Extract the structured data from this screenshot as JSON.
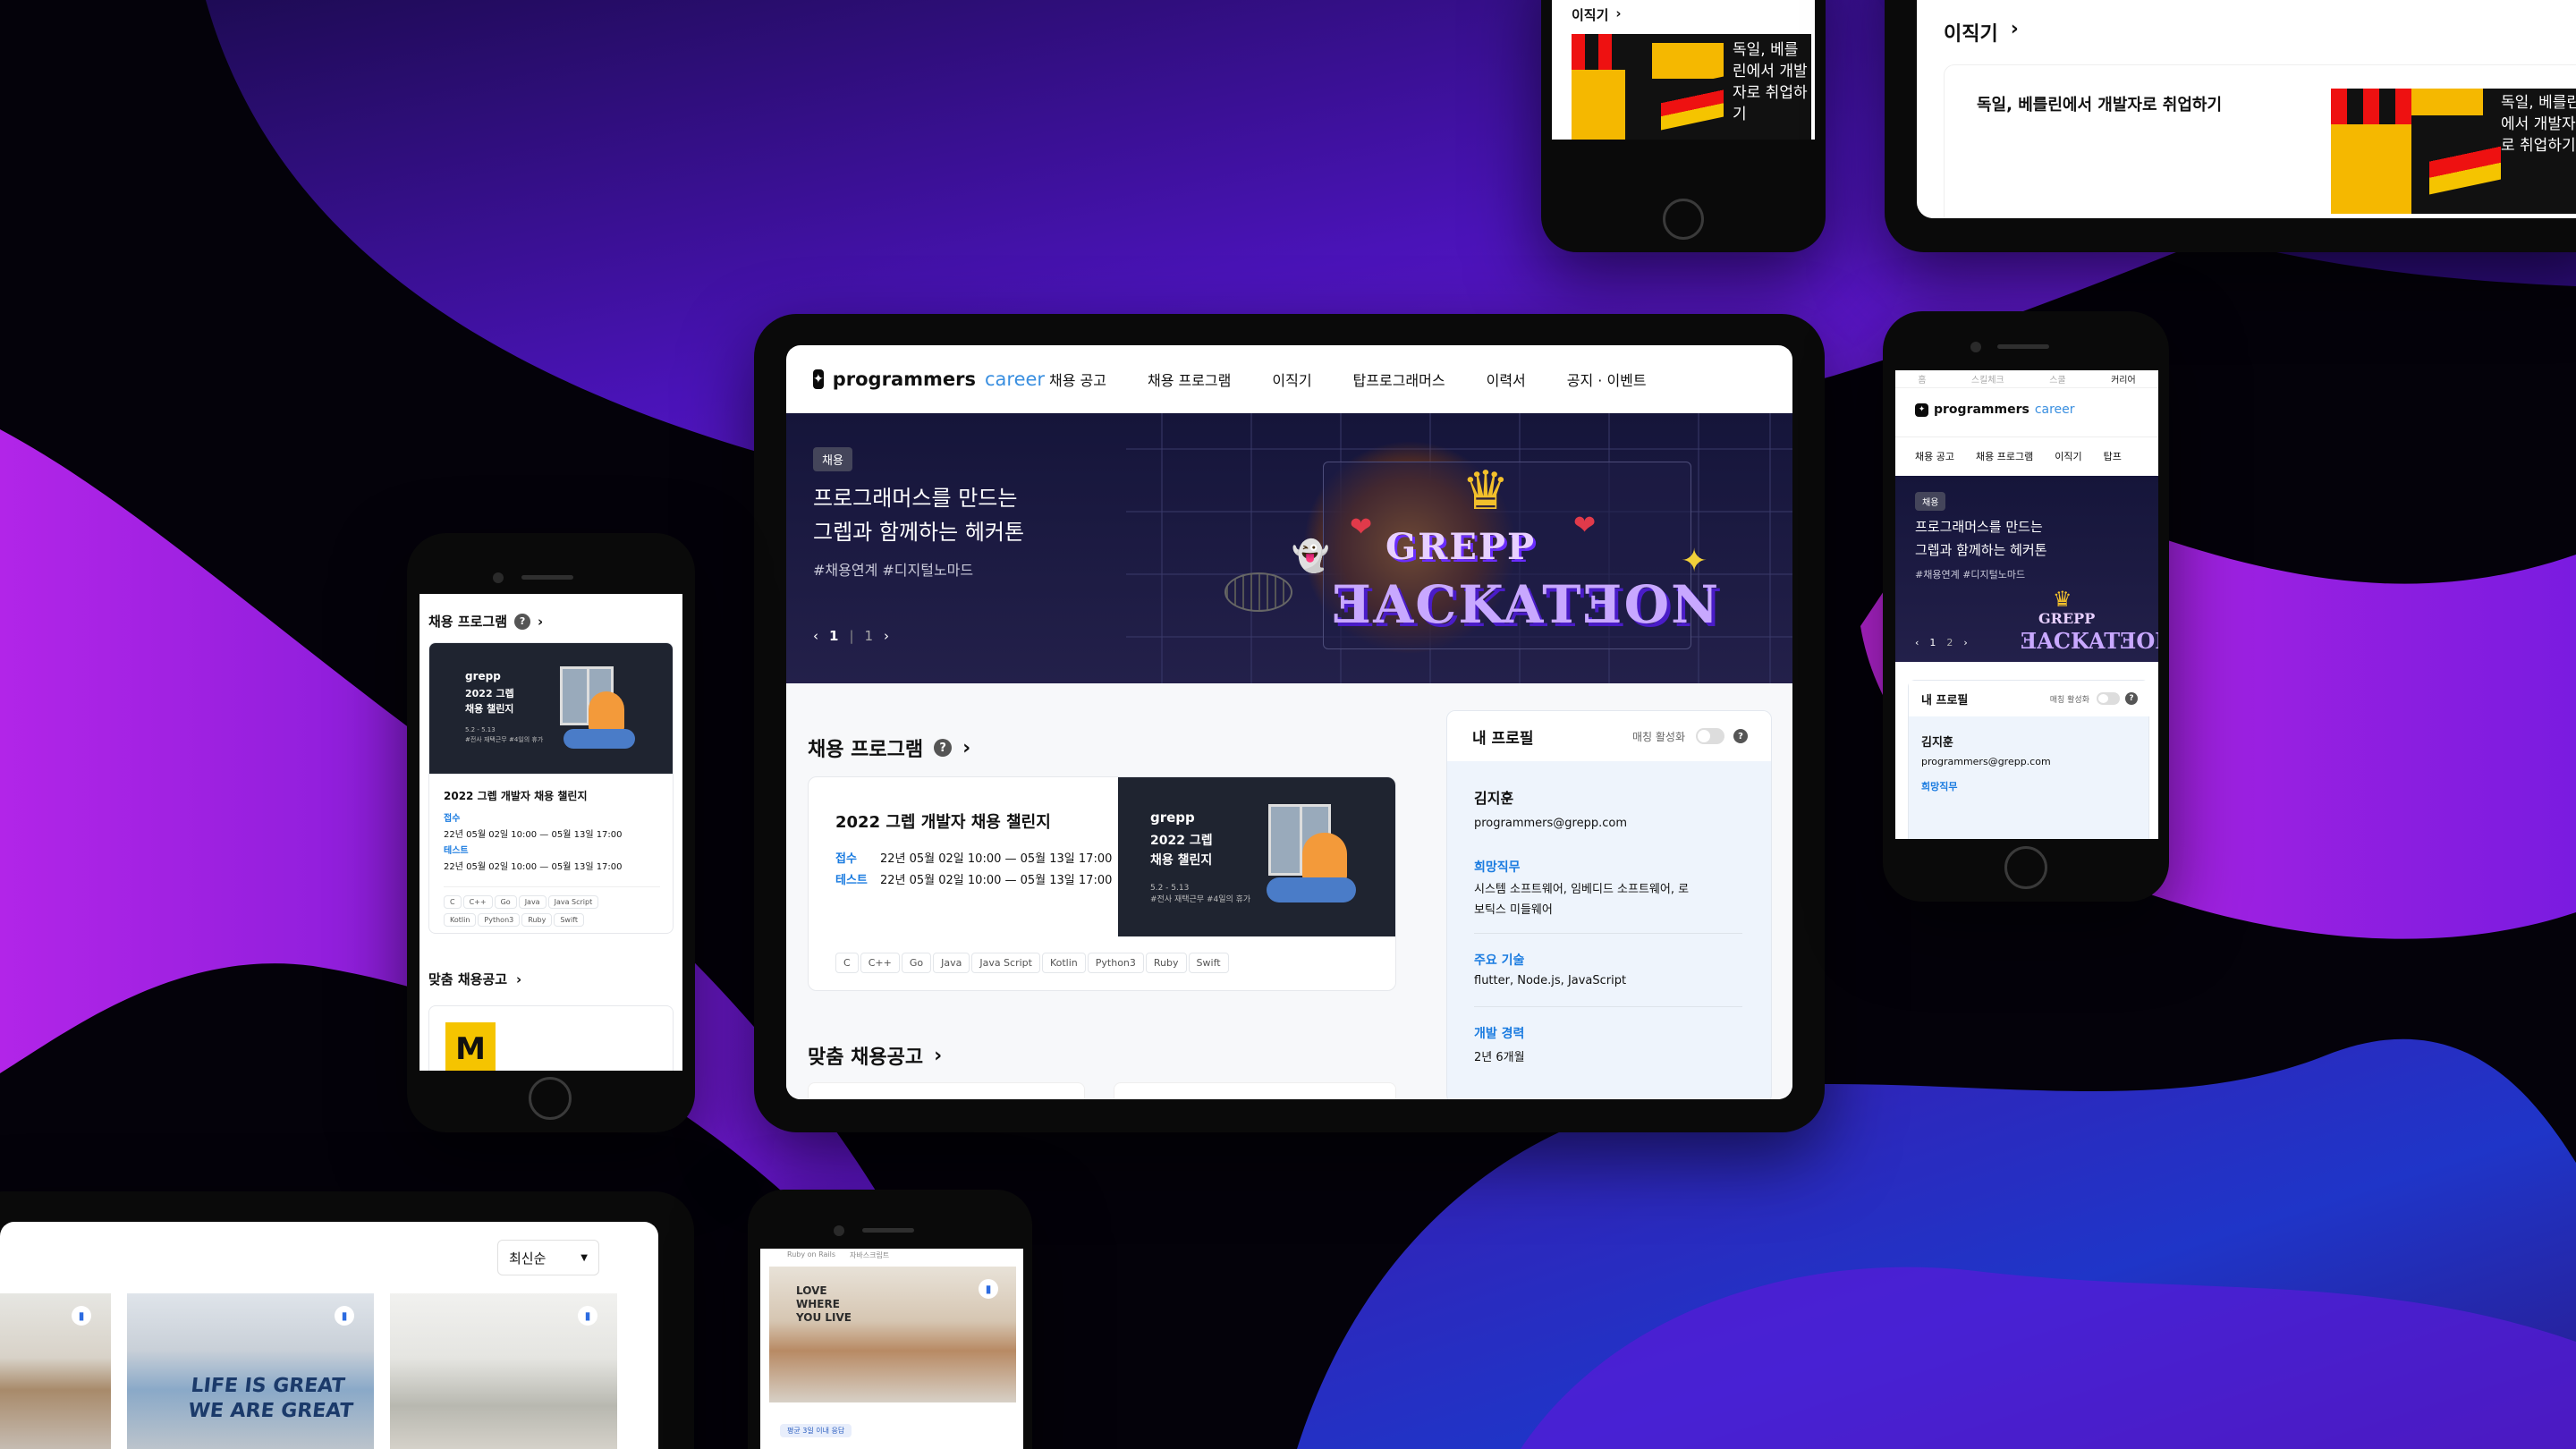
{
  "brand": {
    "name": "programmers",
    "suffix": "career"
  },
  "tablet": {
    "nav": [
      "채용 공고",
      "채용 프로그램",
      "이직기",
      "탑프로그래머스",
      "이력서",
      "공지 · 이벤트"
    ],
    "hero": {
      "badge": "채용",
      "title_line1": "프로그래머스를 만드는",
      "title_line2": "그렙과 함께하는 헤커톤",
      "tags": "#채용연계 #디지털노마드",
      "page_current": "1",
      "page_total": "1",
      "art_line1": "GREPP",
      "art_line2": "ƎACKATƎON"
    },
    "program_section": {
      "title": "채용 프로그램",
      "help": "?"
    },
    "program_card": {
      "title": "2022 그렙 개발자 채용 챌린지",
      "reception_label": "접수",
      "reception_value": "22년 05월 02일 10:00 — 05월 13일 17:00",
      "test_label": "테스트",
      "test_value": "22년 05월 02일 10:00 — 05월 13일 17:00",
      "poster_brand": "grepp",
      "poster_line1": "2022 그렙",
      "poster_line2": "채용 챌린지",
      "poster_date": "5.2 - 5.13",
      "poster_note": "#전사 재택근무 #4일의 휴가",
      "tags": [
        "C",
        "C++",
        "Go",
        "Java",
        "Java Script",
        "Kotlin",
        "Python3",
        "Ruby",
        "Swift"
      ]
    },
    "matching_section": {
      "title": "맞춤 채용공고"
    },
    "profile": {
      "title": "내 프로필",
      "matching_label": "매칭 활성화",
      "help": "?",
      "name": "김지훈",
      "email": "programmers@grepp.com",
      "desired_label": "희망직무",
      "desired_value": "시스템 소프트웨어, 임베디드 소프트웨어, 로보틱스 미들웨어",
      "skills_label": "주요 기술",
      "skills_value": "flutter, Node.js, JavaScript",
      "experience_label": "개발 경력",
      "experience_value": "2년 6개월"
    }
  },
  "phone_left": {
    "section_title": "채용 프로그램",
    "help": "?",
    "poster_brand": "grepp",
    "poster_line1": "2022 그렙",
    "poster_line2": "채용 챌린지",
    "poster_date": "5.2 - 5.13",
    "poster_note": "#전사 재택근무 #4일의 휴가",
    "card_title": "2022 그렙 개발자 채용 챌린지",
    "reception_label": "접수",
    "reception_value": "22년 05월 02일 10:00 — 05월 13일 17:00",
    "test_label": "테스트",
    "test_value": "22년 05월 02일 10:00 — 05월 13일 17:00",
    "tags_row1": [
      "C",
      "C++",
      "Go",
      "Java",
      "Java Script"
    ],
    "tags_row2": [
      "Kotlin",
      "Python3",
      "Ruby",
      "Swift"
    ],
    "matching_title": "맞춤 채용공고",
    "company_logo": "M"
  },
  "phone_right": {
    "top_tabs": [
      "홈",
      "스킬체크",
      "스쿨",
      "커리어"
    ],
    "nav": [
      "채용 공고",
      "채용 프로그램",
      "이직기",
      "탑프"
    ],
    "badge": "채용",
    "title_line1": "프로그래머스를 만드는",
    "title_line2": "그렙과 함께하는 헤커톤",
    "tags": "#채용연계 #디지털노마드",
    "page_current": "1",
    "page_total": "2",
    "art_line1": "GREPP",
    "art_line2": "ƎACKATƎON",
    "profile_title": "내 프로필",
    "matching_label": "매칭 활성화",
    "help": "?",
    "name": "김지훈",
    "email": "programmers@grepp.com",
    "desired_label": "희망직무"
  },
  "phone_top": {
    "section_title": "이직기",
    "art_text": "독일, 베를린에서 개발자로 취업하기"
  },
  "tablet_topright": {
    "section_title": "이직기",
    "article_title": "독일, 베를린에서 개발자로 취업하기",
    "art_text": "독일, 베를린에서 개발자로 취업하기"
  },
  "tablet_bottomleft": {
    "sort_label": "최신순",
    "photo2_text_line1": "LIFE IS GREAT",
    "photo2_text_line2": "WE ARE GREAT"
  },
  "phone_bottom": {
    "top_text_left": "Ruby on Rails",
    "top_text_right": "자바스크립트",
    "photo_text_line1": "LOVE",
    "photo_text_line2": "WHERE",
    "photo_text_line3": "YOU LIVE",
    "bottom_badge": "평균 3일 이내 응답"
  },
  "colors": {
    "accent": "#1a7be0",
    "hero_bg": "#191934",
    "purple": "#8b1fe0"
  }
}
